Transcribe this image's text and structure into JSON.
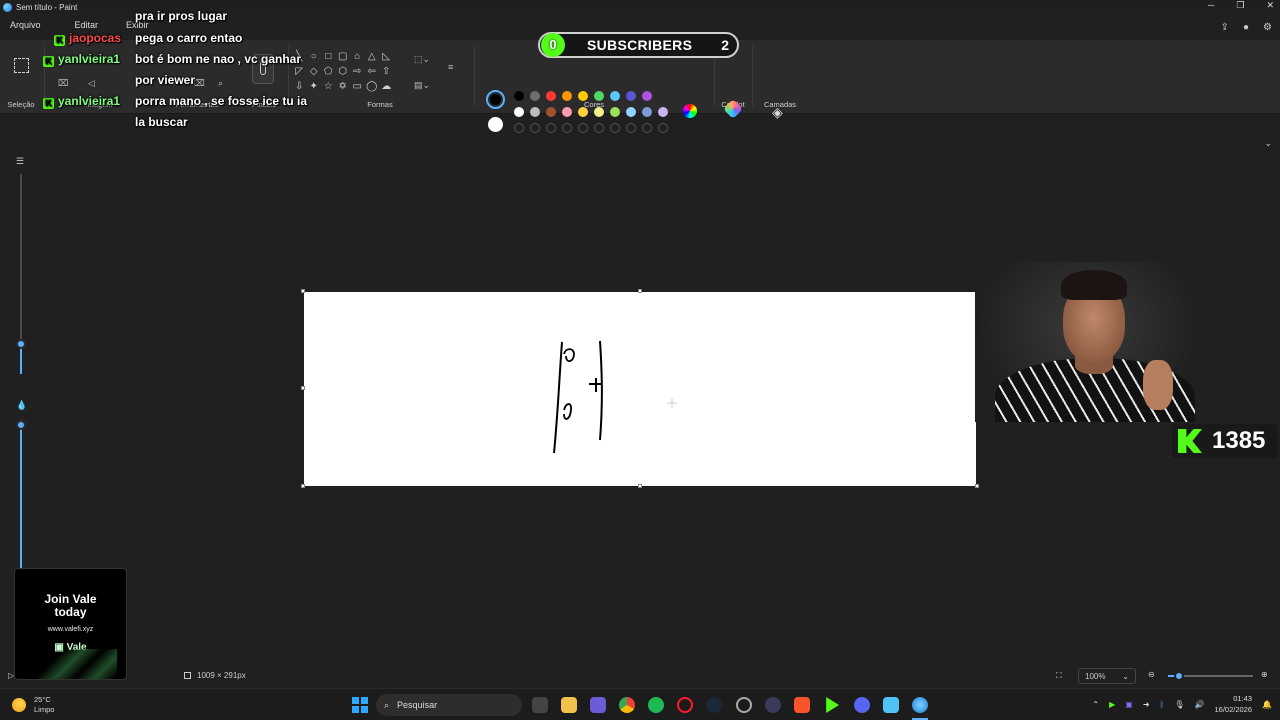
{
  "window": {
    "title": "Sem título - Paint",
    "controls": [
      "─",
      "❐",
      "✕"
    ]
  },
  "menu": {
    "items": [
      "Arquivo",
      "Editar",
      "Exibir"
    ]
  },
  "ribbon": {
    "groups": {
      "selection": "Seleção",
      "image": "Imagem",
      "tools": "Ferramentas",
      "brushes": "Pincéis",
      "shapes": "Formas",
      "colors": "Cores",
      "copilot": "Copilot",
      "layers": "Camadas"
    },
    "shapes_icons": [
      "╲",
      "◯",
      "▭",
      "▢",
      "△",
      "⬠",
      "",
      "◇",
      "⬡",
      "▷",
      "◁",
      "⬦",
      "⬡",
      "",
      "⇩",
      "✦",
      "✩",
      "☆",
      "▱",
      "◯",
      ""
    ],
    "palette_row1": [
      "#000000",
      "#6e6e6e",
      "#ff3b30",
      "#ff9500",
      "#ffcc00",
      "#4cd964",
      "#5ac8fa",
      "#5856d6",
      "#af52de"
    ],
    "palette_row2": [
      "#ffffff",
      "#bdbdbd",
      "#a0522d",
      "#ff9ab0",
      "#ffd23f",
      "#f4f08a",
      "#9be15d",
      "#8fd3ff",
      "#7f9bd6",
      "#c9b4f0"
    ],
    "primary_color": "#000000",
    "secondary_color": "#ffffff"
  },
  "chat": {
    "messages": [
      {
        "user": "",
        "text": "pra ir pros lugar",
        "user_color": ""
      },
      {
        "user": "jaopocas",
        "text": "pega o carro entao",
        "user_color": "#ff4b4b"
      },
      {
        "user": "yanlvieira1",
        "text": "bot é bom ne nao , vc ganhar",
        "user_color": "#7fff7f"
      },
      {
        "user": "",
        "text": "por viewer",
        "user_color": ""
      },
      {
        "user": "yanlvieira1",
        "text": "porra mano , se fosse ice tu ia",
        "user_color": "#7fff7f"
      },
      {
        "user": "",
        "text": "la buscar",
        "user_color": ""
      }
    ]
  },
  "subscribers": {
    "current": "0",
    "label": "SUBSCRIBERS",
    "goal": "2",
    "progress": 0
  },
  "kick": {
    "viewer_count": "1385",
    "accent": "#53fc18"
  },
  "ad": {
    "title_line1": "Join Vale",
    "title_line2": "today",
    "url": "www.valefi.xyz",
    "brand": "Vale"
  },
  "status": {
    "dimensions": "1009 × 291px",
    "zoom": "100%"
  },
  "sliders": {
    "brush_size": 0.15,
    "opacity": 0.0
  },
  "taskbar": {
    "weather_temp": "25°C",
    "weather_desc": "Limpo",
    "search_placeholder": "Pesquisar",
    "time": "01:43",
    "date": "16/02/2026"
  }
}
